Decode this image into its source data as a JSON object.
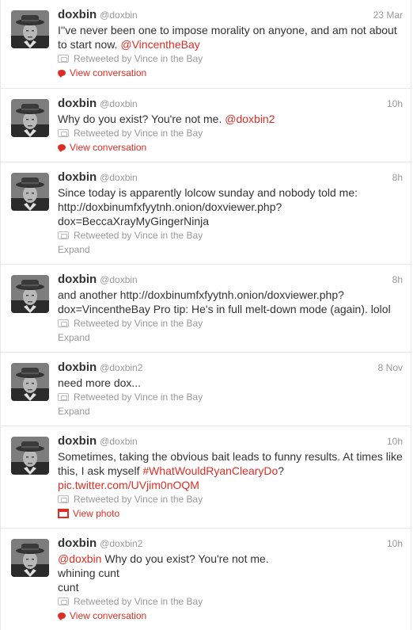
{
  "tweets": [
    {
      "name": "doxbin",
      "handle": "@doxbin",
      "time": "23 Mar",
      "segments": [
        {
          "text": "I''ve never been one to impose morality on anyone, and am not about to start now. "
        },
        {
          "text": "@VincentheBay",
          "link": true
        }
      ],
      "retweet": "Retweeted by Vince in the Bay",
      "action": {
        "type": "conversation",
        "label": "View conversation"
      }
    },
    {
      "name": "doxbin",
      "handle": "@doxbin",
      "time": "10h",
      "segments": [
        {
          "text": "Why do you exist? You're not me. "
        },
        {
          "text": "@doxbin2",
          "link": true
        }
      ],
      "retweet": "Retweeted by Vince in the Bay",
      "action": {
        "type": "conversation",
        "label": "View conversation"
      }
    },
    {
      "name": "doxbin",
      "handle": "@doxbin",
      "time": "8h",
      "segments": [
        {
          "text": "Since today is apparently lolcow sunday and nobody told me:\nhttp://doxbinumfxfyytnh.onion/doxviewer.php?\ndox=BeccaXrayMyGingerNinja"
        }
      ],
      "retweet": "Retweeted by Vince in the Bay",
      "action": {
        "type": "expand",
        "label": "Expand"
      }
    },
    {
      "name": "doxbin",
      "handle": "@doxbin",
      "time": "8h",
      "segments": [
        {
          "text": "and another http://doxbinumfxfyytnh.onion/doxviewer.php?\ndox=VincentheBay Pro tip: He's in full melt-down mode (again). lolol"
        }
      ],
      "retweet": "Retweeted by Vince in the Bay",
      "action": {
        "type": "expand",
        "label": "Expand"
      }
    },
    {
      "name": "doxbin",
      "handle": "@doxbin2",
      "time": "8 Nov",
      "segments": [
        {
          "text": "need more dox..."
        }
      ],
      "retweet": "Retweeted by Vince in the Bay",
      "action": {
        "type": "expand",
        "label": "Expand"
      }
    },
    {
      "name": "doxbin",
      "handle": "@doxbin",
      "time": "10h",
      "segments": [
        {
          "text": "Sometimes, taking the obvious bait leads to funny results. At times like this, I ask myself "
        },
        {
          "text": "#WhatWouldRyanClearyDo",
          "link": true
        },
        {
          "text": "?\n"
        },
        {
          "text": "pic.twitter.com/UVjim0nOQM",
          "link": true
        }
      ],
      "retweet": "Retweeted by Vince in the Bay",
      "action": {
        "type": "photo",
        "label": "View photo"
      }
    },
    {
      "name": "doxbin",
      "handle": "@doxbin2",
      "time": "10h",
      "segments": [
        {
          "text": "@doxbin",
          "link": true
        },
        {
          "text": " Why do you exist? You're not me.\nwhining cunt\ncunt"
        }
      ],
      "retweet": "Retweeted by Vince in the Bay",
      "action": {
        "type": "conversation",
        "label": "View conversation"
      }
    }
  ]
}
